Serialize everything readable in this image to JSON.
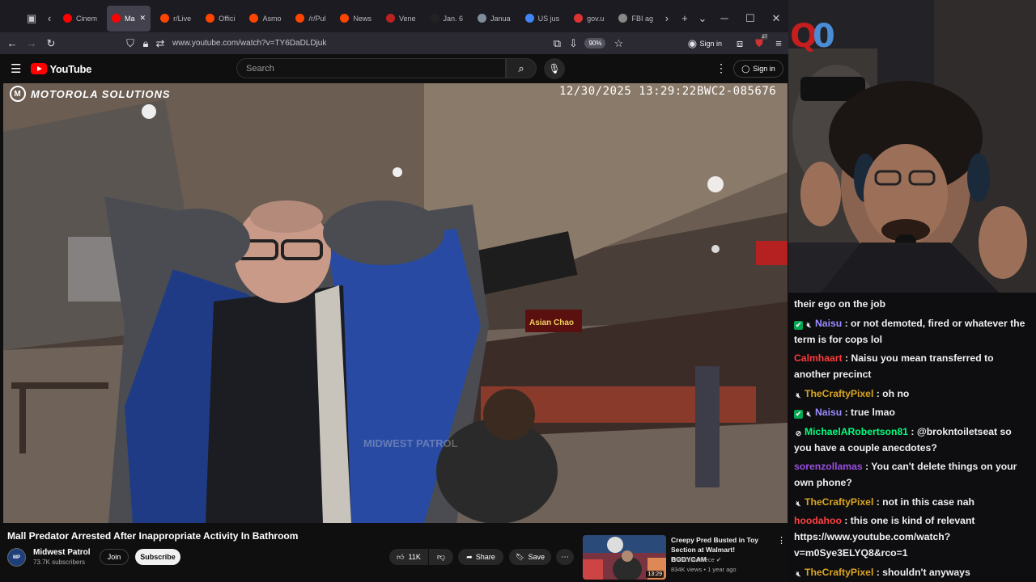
{
  "browser": {
    "tabs": [
      {
        "label": "Cinem",
        "color": "#ff0000"
      },
      {
        "label": "Ma",
        "color": "#ff0000",
        "active": true
      },
      {
        "label": "r/Live",
        "color": "#ff4500"
      },
      {
        "label": "Offici",
        "color": "#ff4500"
      },
      {
        "label": "Asmo",
        "color": "#ff4500"
      },
      {
        "label": "/r/Pul",
        "color": "#ff4500"
      },
      {
        "label": "News",
        "color": "#ff4500"
      },
      {
        "label": "Vene",
        "color": "#b22"
      },
      {
        "label": "Jan. 6",
        "color": "#222"
      },
      {
        "label": "Janua",
        "color": "#7f8c99"
      },
      {
        "label": "US jus",
        "color": "#4285f4"
      },
      {
        "label": "gov.u",
        "color": "#d33"
      },
      {
        "label": "FBI ag",
        "color": "#888"
      }
    ],
    "url": "www.youtube.com/watch?v=TY6DaDLDjuk",
    "zoom": "90%",
    "sign_in": "Sign in",
    "extension_badge": "27"
  },
  "youtube": {
    "logo": "YouTube",
    "search_placeholder": "Search",
    "sign_in": "Sign in"
  },
  "video_overlay": {
    "brand": "MOTOROLA SOLUTIONS",
    "timestamp": "12/30/2025 13:29:22",
    "camera_id": "BWC2-085676",
    "watermark": "MIDWEST PATROL",
    "store_sign": "Asian Chao"
  },
  "video": {
    "title": "Mall Predator Arrested After Inappropriate Activity In Bathroom",
    "channel": "Midwest Patrol",
    "subscribers": "73.7K subscribers",
    "join": "Join",
    "subscribe": "Subscribe",
    "likes": "11K",
    "share": "Share",
    "save": "Save"
  },
  "recommended": {
    "title": "Creepy Pred Busted in Toy Section at Walmart! BODYCAM",
    "channel": "The CrimePiece",
    "meta": "834K views • 1 year ago",
    "duration": "13:29"
  },
  "stream": {
    "logo_left": "Q",
    "logo_right": "0"
  },
  "chat": [
    {
      "user": "",
      "color": "#efeff1",
      "text": "their ego on the job",
      "badges": []
    },
    {
      "user": "Naisu",
      "color": "#9b8cff",
      "text": " : or not demoted, fired or whatever the term is for cops lol",
      "badges": [
        "check",
        "mute"
      ]
    },
    {
      "user": "Calmhaart",
      "color": "#ff3a3a",
      "text": " : Naisu you mean transferred to another precinct",
      "badges": []
    },
    {
      "user": "TheCraftyPixel",
      "color": "#daa520",
      "text": " : oh no",
      "badges": [
        "mute"
      ]
    },
    {
      "user": "Naisu",
      "color": "#9b8cff",
      "text": " : true lmao",
      "badges": [
        "check",
        "mute"
      ]
    },
    {
      "user": "MichaelARobertson81",
      "color": "#00ff7f",
      "text": " : @brokntoiletseat so you have a couple anecdotes?",
      "badges": [
        "no"
      ]
    },
    {
      "user": "sorenzollamas",
      "color": "#9a4ee0",
      "text": " : You can't delete things on your own phone?",
      "badges": []
    },
    {
      "user": "TheCraftyPixel",
      "color": "#daa520",
      "text": " : not in this case nah",
      "badges": [
        "mute"
      ]
    },
    {
      "user": "hoodahoo",
      "color": "#ff4040",
      "text": " : this one is kind of relevant https://www.youtube.com/watch?v=m0Sye3ELYQ8&rco=1",
      "badges": []
    },
    {
      "user": "TheCraftyPixel",
      "color": "#daa520",
      "text": " : shouldn't anyways",
      "badges": [
        "mute"
      ]
    }
  ]
}
